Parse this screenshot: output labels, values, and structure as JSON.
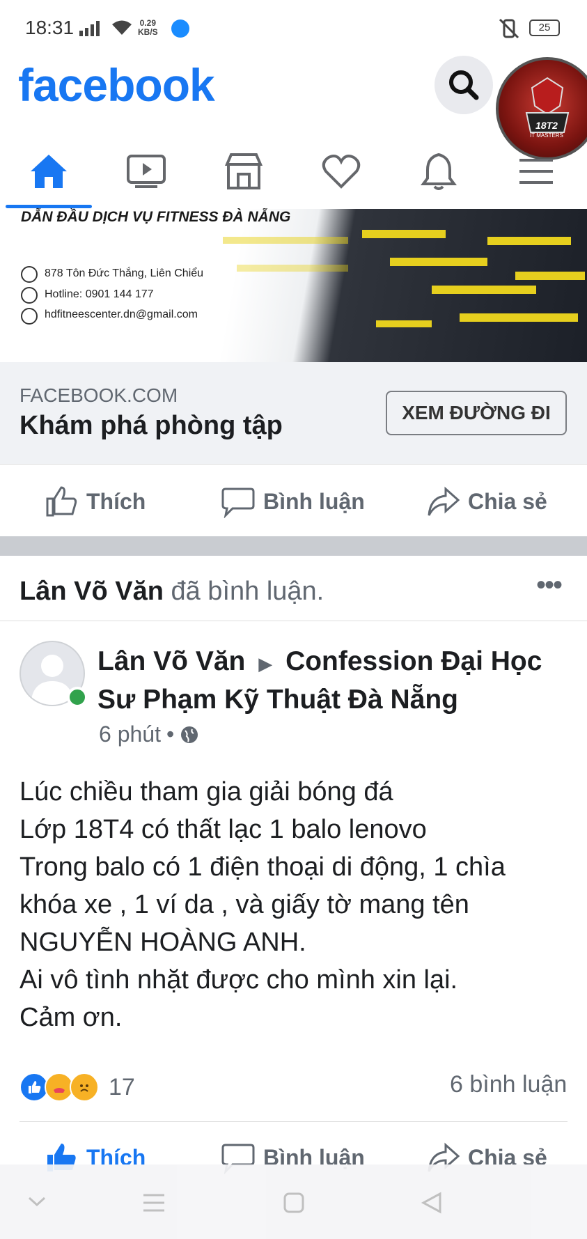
{
  "status_bar": {
    "time": "18:31",
    "speed_value": "0.29",
    "speed_unit": "KB/S",
    "battery": "25"
  },
  "header": {
    "logo": "facebook",
    "avatar_brand": "18T2",
    "avatar_sub": "IT MASTERS"
  },
  "nav": {
    "items": [
      "home-icon",
      "watch-icon",
      "marketplace-icon",
      "dating-icon",
      "notifications-icon",
      "menu-icon"
    ],
    "active": "home",
    "accent": "#1877f2"
  },
  "ad": {
    "banner_title": "DẪN ĐẦU DỊCH VỤ FITNESS ĐÀ NẴNG",
    "address": "878 Tôn Đức Thắng, Liên Chiểu",
    "hotline": "Hotline: 0901 144 177",
    "email": "hdfitneescenter.dn@gmail.com",
    "domain": "FACEBOOK.COM",
    "title": "Khám phá phòng tập",
    "cta": "XEM ĐƯỜNG ĐI"
  },
  "actions_top": {
    "like": "Thích",
    "comment": "Bình luận",
    "share": "Chia sẻ"
  },
  "post": {
    "activity_name": "Lân Võ Văn",
    "activity_text": "đã bình luận.",
    "more": "•••",
    "author": "Lân Võ Văn",
    "arrow": "▶",
    "group": "Confession Đại Học Sư Phạm Kỹ Thuật Đà Nẵng",
    "time": "6 phút",
    "dot": "•",
    "body_lines": [
      "Lúc chiều tham gia giải bóng đá",
      "Lớp 18T4 có thất lạc 1 balo lenovo",
      "Trong balo có 1 điện thoại di động, 1 chìa",
      "khóa xe , 1 ví da , và giấy tờ mang tên",
      "NGUYỄN HOÀNG ANH.",
      "Ai vô tình nhặt được cho mình xin lại.",
      "Cảm ơn."
    ],
    "reaction_count": "17",
    "comment_count": "6 bình luận"
  },
  "actions_bottom": {
    "like": "Thích",
    "comment": "Bình luận",
    "share": "Chia sẻ",
    "like_color": "#1877f2"
  }
}
